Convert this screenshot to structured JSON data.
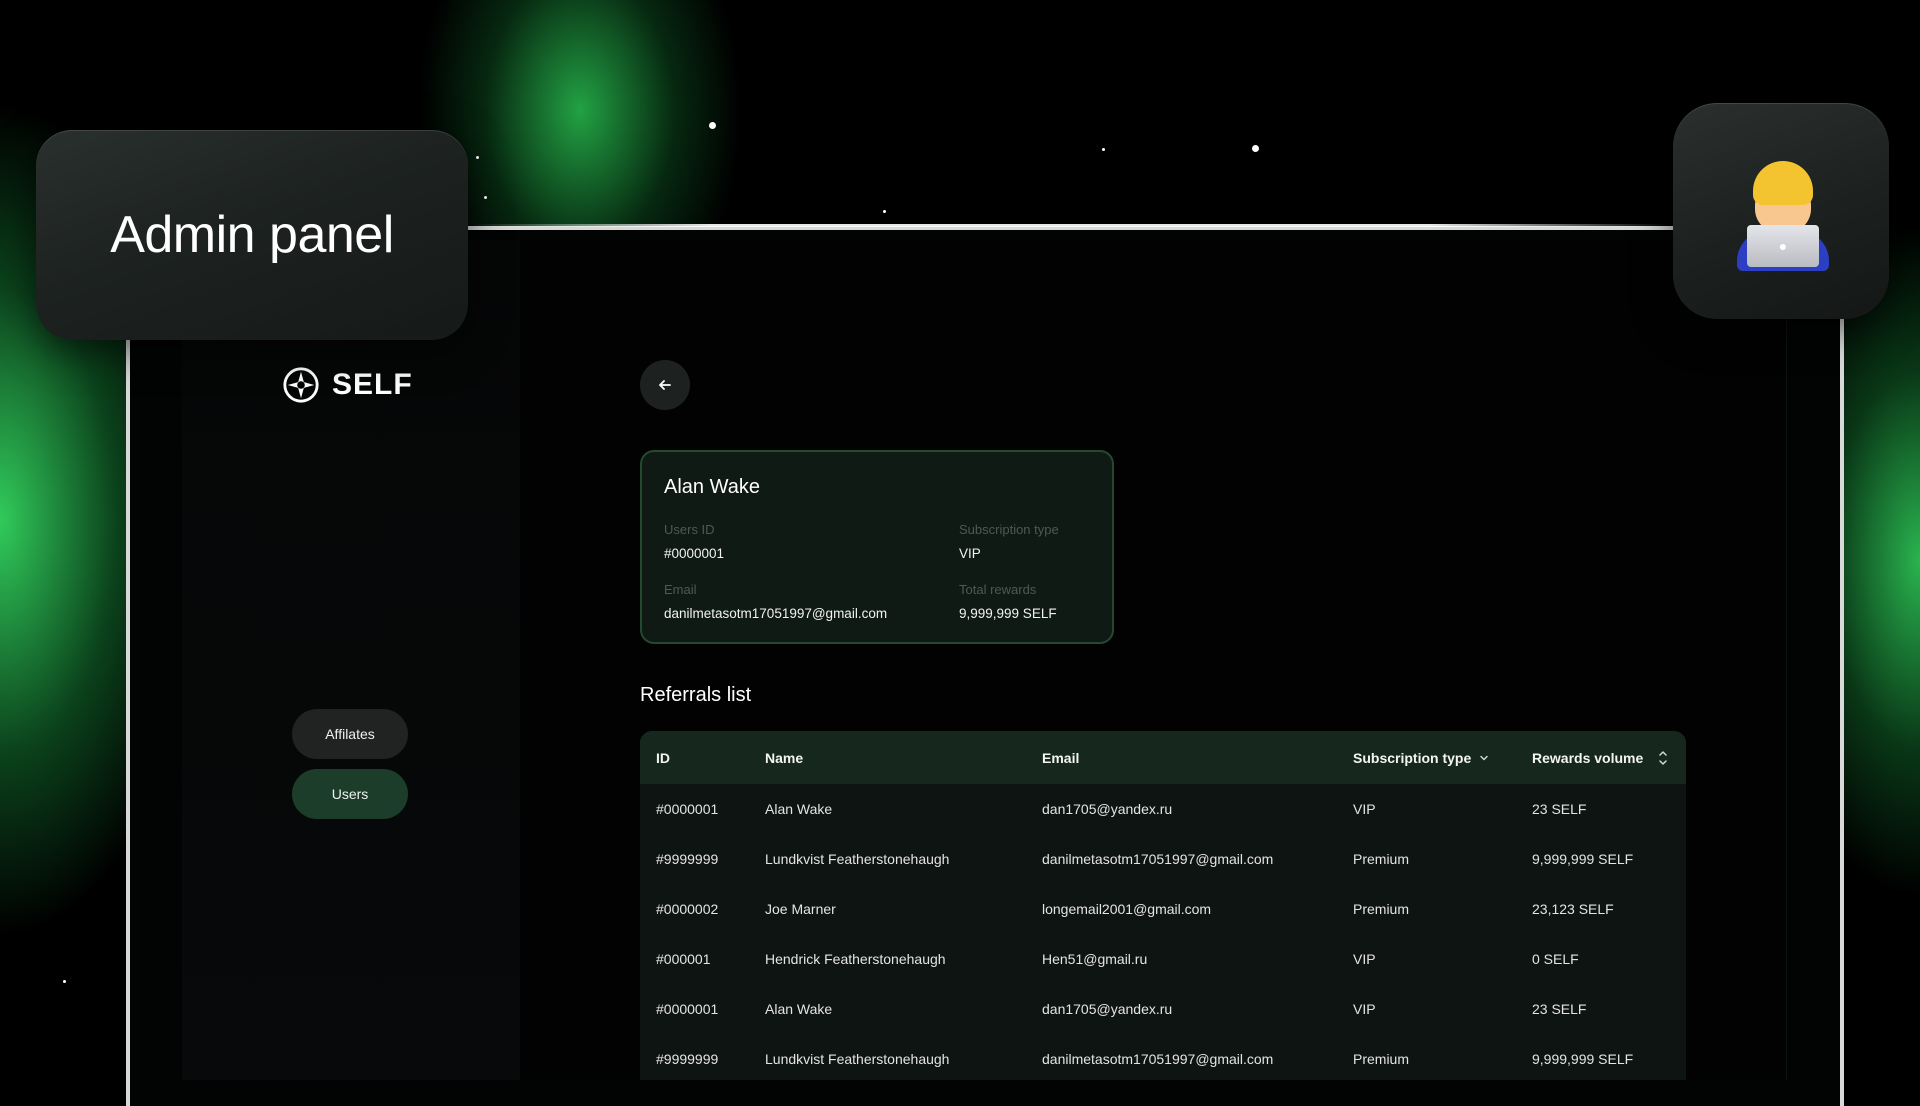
{
  "promo": {
    "title": "Admin panel"
  },
  "app": {
    "logo_text": "SELF"
  },
  "nav": {
    "items": [
      {
        "label": "Affilates",
        "active": false
      },
      {
        "label": "Users",
        "active": true
      }
    ]
  },
  "user": {
    "name": "Alan Wake",
    "id_label": "Users ID",
    "id_value": "#0000001",
    "subscription_label": "Subscription type",
    "subscription_value": "VIP",
    "email_label": "Email",
    "email_value": "danilmetasotm17051997@gmail.com",
    "rewards_label": "Total rewards",
    "rewards_value": "9,999,999 SELF"
  },
  "referrals": {
    "title": "Referrals list",
    "columns": {
      "id": "ID",
      "name": "Name",
      "email": "Email",
      "subscription": "Subscription type",
      "rewards": "Rewards volume"
    },
    "rows": [
      {
        "id": "#0000001",
        "name": "Alan Wake",
        "email": "dan1705@yandex.ru",
        "subscription": "VIP",
        "rewards": "23 SELF"
      },
      {
        "id": "#9999999",
        "name": "Lundkvist Featherstonehaugh",
        "email": "danilmetasotm17051997@gmail.com",
        "subscription": "Premium",
        "rewards": "9,999,999 SELF"
      },
      {
        "id": "#0000002",
        "name": "Joe Marner",
        "email": "longemail2001@gmail.com",
        "subscription": "Premium",
        "rewards": "23,123 SELF"
      },
      {
        "id": "#000001",
        "name": "Hendrick Featherstonehaugh",
        "email": "Hen51@gmail.ru",
        "subscription": "VIP",
        "rewards": "0 SELF"
      },
      {
        "id": "#0000001",
        "name": "Alan Wake",
        "email": "dan1705@yandex.ru",
        "subscription": "VIP",
        "rewards": "23 SELF"
      },
      {
        "id": "#9999999",
        "name": "Lundkvist Featherstonehaugh",
        "email": "danilmetasotm17051997@gmail.com",
        "subscription": "Premium",
        "rewards": "9,999,999 SELF"
      }
    ]
  },
  "icons": {
    "back": "arrow-left-icon",
    "logo": "self-logo-icon",
    "subscription_sort": "chevron-down-icon",
    "rewards_sort": "sort-updown-icon",
    "emoji": "technologist-emoji-icon"
  },
  "colors": {
    "accent_green": "#1c3d2a",
    "table_header": "#16281d",
    "card_border": "#234a31"
  }
}
